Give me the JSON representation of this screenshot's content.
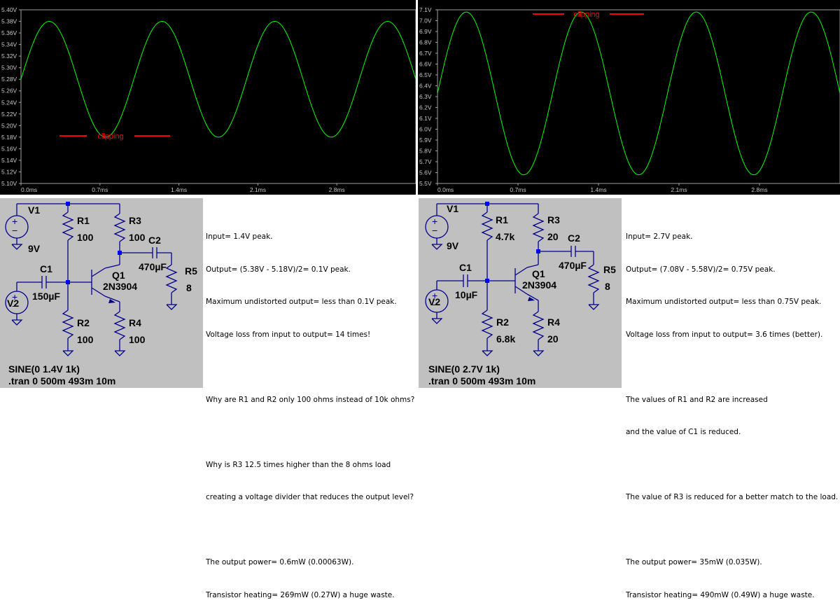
{
  "left": {
    "waveform": {
      "y_ticks": [
        "5.40V",
        "5.38V",
        "5.36V",
        "5.34V",
        "5.32V",
        "5.30V",
        "5.28V",
        "5.26V",
        "5.24V",
        "5.22V",
        "5.20V",
        "5.18V",
        "5.16V",
        "5.14V",
        "5.12V",
        "5.10V"
      ],
      "x_ticks": [
        "0.0ms",
        "0.7ms",
        "1.4ms",
        "2.1ms",
        "2.8ms"
      ],
      "annotation": "clipping",
      "chart_data": {
        "type": "line",
        "x_unit": "ms",
        "y_unit": "V",
        "xlim": [
          0,
          3.5
        ],
        "ylim": [
          5.1,
          5.4
        ],
        "frequency_khz": 1,
        "max": 5.38,
        "min": 5.18,
        "start_value": 5.28
      },
      "trace_color": "#00ff00",
      "annotation_color": "#ff0000"
    },
    "schematic": {
      "labels": {
        "v1": "V1",
        "v1_val": "9V",
        "r1": "R1",
        "r1_val": "100",
        "r3": "R3",
        "r3_val": "100",
        "c2": "C2",
        "c2_val": "470µF",
        "r5": "R5",
        "r5_val": "8",
        "c1": "C1",
        "c1_val": "150µF",
        "q1": "Q1",
        "q1_val": "2N3904",
        "v2": "V2",
        "r2": "R2",
        "r2_val": "100",
        "r4": "R4",
        "r4_val": "100"
      },
      "directive1": "SINE(0 1.4V 1k)",
      "directive2": ".tran 0 500m 493m 10m"
    },
    "notes": [
      "Input= 1.4V peak.",
      "Output= (5.38V - 5.18V)/2= 0.1V peak.",
      "Maximum undistorted output= less than 0.1V peak.",
      "Voltage loss from input to output= 14 times!",
      "",
      "Why are R1 and R2 only 100 ohms instead of 10k ohms?",
      "",
      "Why is R3 12.5 times higher than the 8 ohms load",
      "creating a voltage divider that reduces the output level?",
      "",
      "The output power= 0.6mW (0.00063W).",
      "Transistor heating= 269mW (0.27W) a huge waste."
    ]
  },
  "right": {
    "waveform": {
      "y_ticks": [
        "7.1V",
        "7.0V",
        "6.9V",
        "6.8V",
        "6.7V",
        "6.6V",
        "6.5V",
        "6.4V",
        "6.3V",
        "6.2V",
        "6.1V",
        "6.0V",
        "5.9V",
        "5.8V",
        "5.7V",
        "5.6V",
        "5.5V"
      ],
      "x_ticks": [
        "0.0ms",
        "0.7ms",
        "1.4ms",
        "2.1ms",
        "2.8ms"
      ],
      "annotation": "clipping",
      "chart_data": {
        "type": "line",
        "x_unit": "ms",
        "y_unit": "V",
        "xlim": [
          0,
          3.5
        ],
        "ylim": [
          5.5,
          7.1
        ],
        "frequency_khz": 1,
        "max": 7.08,
        "min": 5.58,
        "start_value": 6.33
      },
      "trace_color": "#00ff00",
      "annotation_color": "#ff0000"
    },
    "schematic": {
      "labels": {
        "v1": "V1",
        "v1_val": "9V",
        "r1": "R1",
        "r1_val": "4.7k",
        "r3": "R3",
        "r3_val": "20",
        "c2": "C2",
        "c2_val": "470µF",
        "r5": "R5",
        "r5_val": "8",
        "c1": "C1",
        "c1_val": "10µF",
        "q1": "Q1",
        "q1_val": "2N3904",
        "v2": "V2",
        "r2": "R2",
        "r2_val": "6.8k",
        "r4": "R4",
        "r4_val": "20"
      },
      "directive1": "SINE(0 2.7V 1k)",
      "directive2": ".tran 0 500m 493m 10m"
    },
    "notes": [
      "Input= 2.7V peak.",
      "Output= (7.08V - 5.58V)/2= 0.75V peak.",
      "Maximum undistorted output= less than 0.75V peak.",
      "Voltage loss from input to output= 3.6 times (better).",
      "",
      "The values of R1 and R2 are increased",
      "and the value of C1 is reduced.",
      "",
      "The value of R3 is reduced for a better match to the load.",
      "",
      "The output power= 35mW (0.035W).",
      "Transistor heating= 490mW (0.49W) a huge waste."
    ]
  },
  "colors": {
    "wire": "#00008b",
    "node": "#0000ff",
    "schematic_bg": "#c0c0c0",
    "plot_bg": "#000000",
    "axis": "#a0a0a0"
  }
}
